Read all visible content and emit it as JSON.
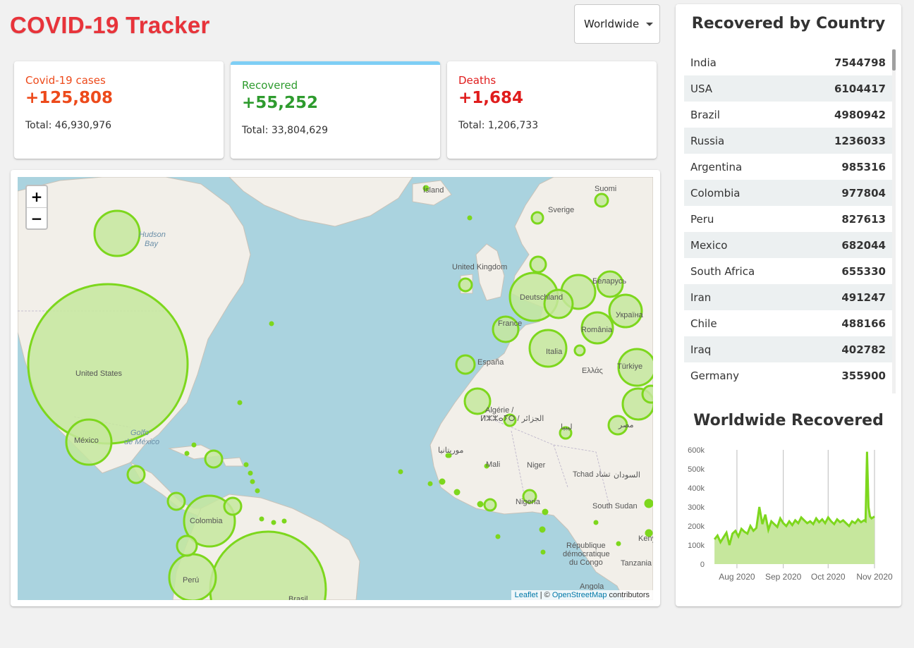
{
  "app": {
    "title": "COVID-19 Tracker"
  },
  "country_select": {
    "value": "Worldwide"
  },
  "info_boxes": [
    {
      "title": "Covid-19 cases",
      "cases": "+125,808",
      "total": "Total: 46,930,976",
      "color": "#ed4a1b"
    },
    {
      "title": "Recovered",
      "cases": "+55,252",
      "total": "Total: 33,804,629",
      "color": "#2e9b2e"
    },
    {
      "title": "Deaths",
      "cases": "+1,684",
      "total": "Total: 1,206,733",
      "color": "#e01d1d"
    }
  ],
  "map": {
    "zoom_in": "+",
    "zoom_out": "−",
    "attribution": {
      "leaflet": "Leaflet",
      "separator": " | © ",
      "osm": "OpenStreetMap",
      "suffix": " contributors"
    },
    "labels": [
      "Ísland",
      "Suomi",
      "Sverige",
      "United Kingdom",
      "Беларусь",
      "Deutschland",
      "France",
      "Україна",
      "România",
      "Italia",
      "España",
      "Türkiye",
      "Ελλάς",
      "Algérie /",
      "ⵍⵣⵣⴰⵢⵔ / الجزائر",
      "مصر",
      "ليبيا",
      "موريتانيا",
      "Mali",
      "Niger",
      "Tchad تشاد",
      "السودان",
      "Nigeria",
      "South Sudan",
      "République",
      "démocratique",
      "du Congo",
      "Kenya",
      "Tanzania",
      "Angola",
      "Hudson",
      "Bay",
      "United States",
      "México",
      "Golfo",
      "de México",
      "Colombia",
      "Perú",
      "Brasil"
    ],
    "circle_color": "#7dd71d"
  },
  "sidebar": {
    "table_title": "Recovered by Country",
    "countries": [
      {
        "name": "India",
        "value": "7544798"
      },
      {
        "name": "USA",
        "value": "6104417"
      },
      {
        "name": "Brazil",
        "value": "4980942"
      },
      {
        "name": "Russia",
        "value": "1236033"
      },
      {
        "name": "Argentina",
        "value": "985316"
      },
      {
        "name": "Colombia",
        "value": "977804"
      },
      {
        "name": "Peru",
        "value": "827613"
      },
      {
        "name": "Mexico",
        "value": "682044"
      },
      {
        "name": "South Africa",
        "value": "655330"
      },
      {
        "name": "Iran",
        "value": "491247"
      },
      {
        "name": "Chile",
        "value": "488166"
      },
      {
        "name": "Iraq",
        "value": "402782"
      },
      {
        "name": "Germany",
        "value": "355900"
      }
    ],
    "chart_title": "Worldwide Recovered"
  },
  "chart_data": {
    "type": "area",
    "title": "Worldwide Recovered",
    "xlabel": "",
    "ylabel": "",
    "x_ticks": [
      "Aug 2020",
      "Sep 2020",
      "Oct 2020",
      "Nov 2020"
    ],
    "y_ticks": [
      "0",
      "100k",
      "200k",
      "300k",
      "400k",
      "500k",
      "600k"
    ],
    "ylim": [
      0,
      600000
    ],
    "xlim": [
      "2020-07-16",
      "2020-11-01"
    ],
    "fill_color": "rgba(204,16,52,0.5)",
    "line_color": "#CC1034",
    "series": [
      {
        "x": [
          "2020-07-17",
          "2020-07-19",
          "2020-07-21",
          "2020-07-23",
          "2020-07-25",
          "2020-07-27",
          "2020-07-29",
          "2020-07-31",
          "2020-08-02",
          "2020-08-04",
          "2020-08-06",
          "2020-08-08",
          "2020-08-10",
          "2020-08-12",
          "2020-08-14",
          "2020-08-16",
          "2020-08-18",
          "2020-08-20",
          "2020-08-22",
          "2020-08-24",
          "2020-08-26",
          "2020-08-28",
          "2020-08-30",
          "2020-09-01",
          "2020-09-03",
          "2020-09-05",
          "2020-09-07",
          "2020-09-09",
          "2020-09-11",
          "2020-09-13",
          "2020-09-15",
          "2020-09-17",
          "2020-09-19",
          "2020-09-21",
          "2020-09-23",
          "2020-09-25",
          "2020-09-27",
          "2020-09-29",
          "2020-10-01",
          "2020-10-03",
          "2020-10-05",
          "2020-10-07",
          "2020-10-09",
          "2020-10-11",
          "2020-10-13",
          "2020-10-15",
          "2020-10-17",
          "2020-10-19",
          "2020-10-21",
          "2020-10-23",
          "2020-10-25",
          "2020-10-26",
          "2020-10-27",
          "2020-10-28",
          "2020-10-29",
          "2020-10-30",
          "2020-11-01"
        ],
        "values": [
          130000,
          150000,
          115000,
          140000,
          165000,
          100000,
          160000,
          175000,
          145000,
          185000,
          170000,
          160000,
          200000,
          175000,
          190000,
          300000,
          210000,
          260000,
          180000,
          225000,
          210000,
          195000,
          240000,
          215000,
          200000,
          225000,
          205000,
          230000,
          215000,
          245000,
          230000,
          215000,
          225000,
          210000,
          240000,
          220000,
          235000,
          215000,
          245000,
          225000,
          210000,
          235000,
          220000,
          230000,
          215000,
          200000,
          225000,
          215000,
          235000,
          220000,
          230000,
          225000,
          590000,
          300000,
          250000,
          240000,
          250000
        ]
      }
    ]
  }
}
